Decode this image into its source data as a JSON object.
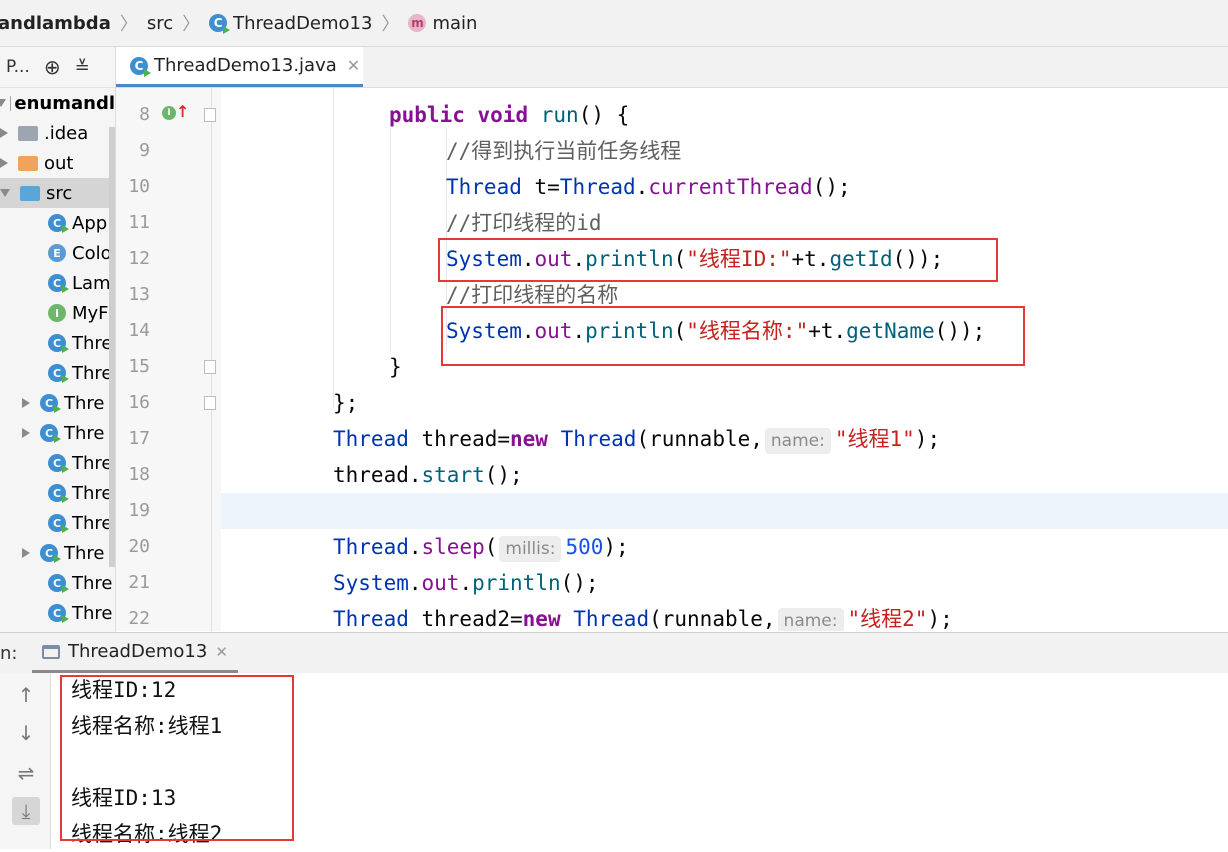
{
  "breadcrumb": {
    "project": "andlambda",
    "folder": "src",
    "class": "ThreadDemo13",
    "method": "main"
  },
  "project_panel": {
    "toolbar_label": "P...",
    "root": "enumandl",
    "items": [
      {
        "label": ".idea",
        "type": "folder-gray",
        "arrow": "right"
      },
      {
        "label": "out",
        "type": "folder-orange",
        "arrow": "right"
      },
      {
        "label": "src",
        "type": "folder-blue",
        "arrow": "down"
      },
      {
        "label": "App",
        "type": "class"
      },
      {
        "label": "Colo",
        "type": "enum"
      },
      {
        "label": "Lam",
        "type": "class"
      },
      {
        "label": "MyF",
        "type": "interface"
      },
      {
        "label": "Thre",
        "type": "class"
      },
      {
        "label": "Thre",
        "type": "class"
      },
      {
        "label": "Thre",
        "type": "class",
        "arrow": "right"
      },
      {
        "label": "Thre",
        "type": "class",
        "arrow": "right"
      },
      {
        "label": "Thre",
        "type": "class"
      },
      {
        "label": "Thre",
        "type": "class"
      },
      {
        "label": "Thre",
        "type": "class"
      },
      {
        "label": "Thre",
        "type": "class",
        "arrow": "right"
      },
      {
        "label": "Thre",
        "type": "class"
      },
      {
        "label": "Thre",
        "type": "class"
      }
    ]
  },
  "editor": {
    "tab_label": "ThreadDemo13.java",
    "line_numbers": [
      "8",
      "9",
      "10",
      "11",
      "12",
      "13",
      "14",
      "15",
      "16",
      "17",
      "18",
      "19",
      "20",
      "21",
      "22"
    ],
    "code": {
      "l8_public": "public",
      "l8_void": "void",
      "l8_run": "run",
      "l8_rest": "() {",
      "l9_comment": "//得到执行当前任务线程",
      "l10_type": "Thread",
      "l10_var": " t=",
      "l10_cls": "Thread",
      "l10_dot": ".",
      "l10_method": "currentThread",
      "l10_end": "();",
      "l11_comment": "//打印线程的id",
      "l12_sys": "System",
      "l12_dot1": ".",
      "l12_out": "out",
      "l12_dot2": ".",
      "l12_println": "println",
      "l12_open": "(",
      "l12_str": "\"线程ID:\"",
      "l12_plus": "+t.",
      "l12_getid": "getId",
      "l12_end": "());",
      "l13_comment": "//打印线程的名称",
      "l14_sys": "System",
      "l14_dot1": ".",
      "l14_out": "out",
      "l14_dot2": ".",
      "l14_println": "println",
      "l14_open": "(",
      "l14_str": "\"线程名称:\"",
      "l14_plus": "+t.",
      "l14_getname": "getName",
      "l14_end": "());",
      "l15": "}",
      "l16": "};",
      "l17_type": "Thread",
      "l17_var": " thread=",
      "l17_new": "new",
      "l17_cls": " Thread",
      "l17_args": "(runnable,",
      "l17_hint": "name:",
      "l17_str": "\"线程1\"",
      "l17_end": ");",
      "l18_var": "thread.",
      "l18_method": "start",
      "l18_end": "();",
      "l20_cls": "Thread",
      "l20_dot": ".",
      "l20_method": "sleep",
      "l20_open": "(",
      "l20_hint": "millis:",
      "l20_num": "500",
      "l20_end": ");",
      "l21_sys": "System",
      "l21_dot1": ".",
      "l21_out": "out",
      "l21_dot2": ".",
      "l21_println": "println",
      "l21_end": "();",
      "l22_type": "Thread",
      "l22_var": " thread2=",
      "l22_new": "new",
      "l22_cls": " Thread",
      "l22_args": "(runnable,",
      "l22_hint": "name:",
      "l22_str": "\"线程2\"",
      "l22_end": ");"
    }
  },
  "run_panel": {
    "prefix": "n:",
    "tab_label": "ThreadDemo13",
    "output": [
      "线程ID:12",
      "线程名称:线程1",
      "",
      "线程ID:13",
      "线程名称:线程2"
    ]
  },
  "colors": {
    "highlight_box": "#e53935",
    "tab_underline": "#4a88c7",
    "keyword": "#0033b3",
    "string": "#c5221f"
  }
}
